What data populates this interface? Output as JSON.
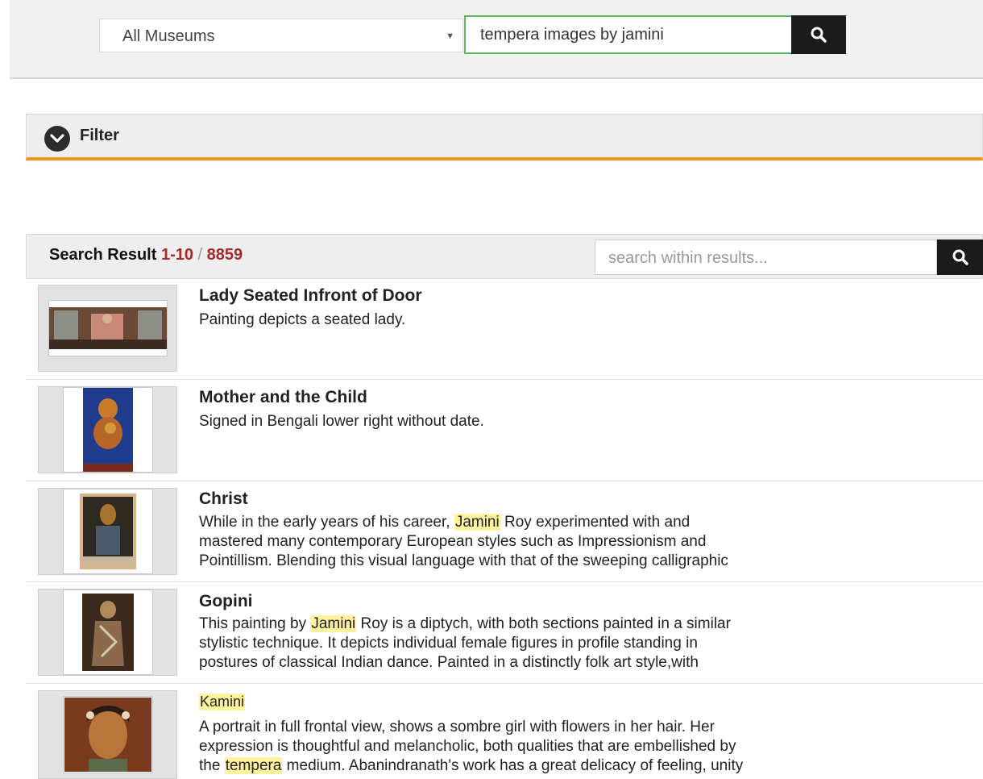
{
  "search": {
    "scope_selected": "All Museums",
    "query": "tempera images by jamini",
    "colors": {
      "accent_border": "#5cb85c",
      "button_bg": "#1b1b1b"
    }
  },
  "filter": {
    "label": "Filter",
    "accent": "#f7931e"
  },
  "results": {
    "heading": "Search Result",
    "range": "1-10",
    "separator": "/",
    "total": "8859",
    "within_placeholder": "search within results...",
    "items": [
      {
        "title": "Lady Seated Infront of Door",
        "desc1": "Painting depicts a seated lady."
      },
      {
        "title": "Mother and the Child",
        "desc1": "Signed in Bengali lower right without date."
      },
      {
        "title": "Christ",
        "desc1_pre": "While in the early years of his career, ",
        "desc1_mark": "Jamini",
        "desc1_post": " Roy experimented with and",
        "desc2": "mastered many contemporary European styles such as Impressionism and",
        "desc3": "Pointillism. Blending this visual language with that of the sweeping calligraphic"
      },
      {
        "title": "Gopini",
        "desc1_pre": "This painting by ",
        "desc1_mark": "Jamini",
        "desc1_post": " Roy is a diptych, with both sections painted in a similar",
        "desc2": "stylistic technique. It depicts individual female figures in profile standing in",
        "desc3": "postures of classical Indian dance. Painted in a distinctly folk art style,with"
      },
      {
        "title": "Kamini",
        "desc1": "A portrait in full frontal view, shows a sombre girl with flowers in her hair. Her",
        "desc2": "expression is thoughtful and melancholic, both qualities that are embellished by",
        "desc3_pre": "the ",
        "desc3_mark": "tempera",
        "desc3_post": " medium. Abanindranath's work has a great delicacy of feeling, unity"
      }
    ]
  }
}
